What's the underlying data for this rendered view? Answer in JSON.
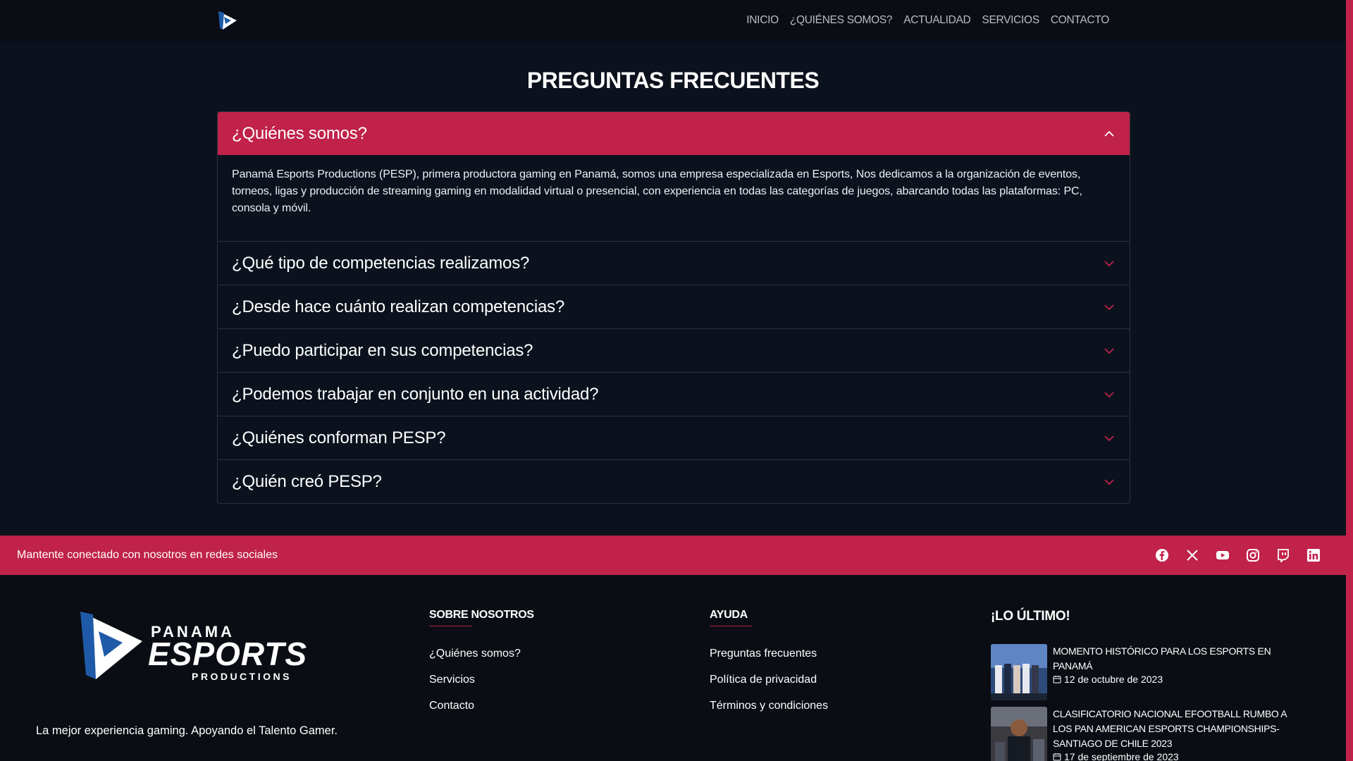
{
  "nav": {
    "items": [
      "INICIO",
      "¿QUIÉNES SOMOS?",
      "ACTUALIDAD",
      "SERVICIOS",
      "CONTACTO"
    ]
  },
  "page": {
    "title": "PREGUNTAS FRECUENTES"
  },
  "faq": {
    "items": [
      {
        "question": "¿Quiénes somos?",
        "answer": "Panamá Esports Productions (PESP), primera productora gaming en Panamá, somos una empresa especializada en Esports, Nos dedicamos a la organización de eventos, torneos, ligas y producción de streaming gaming en modalidad virtual o presencial, con experiencia en todas las categorías de juegos, abarcando todas las plataformas: PC, consola y móvil.",
        "open": true
      },
      {
        "question": "¿Qué tipo de competencias realizamos?",
        "open": false
      },
      {
        "question": "¿Desde hace cuánto realizan competencias?",
        "open": false
      },
      {
        "question": "¿Puedo participar en sus competencias?",
        "open": false
      },
      {
        "question": "¿Podemos trabajar en conjunto en una actividad?",
        "open": false
      },
      {
        "question": "¿Quiénes conforman PESP?",
        "open": false
      },
      {
        "question": "¿Quién creó PESP?",
        "open": false
      }
    ]
  },
  "social": {
    "text": "Mantente conectado con nosotros en redes sociales",
    "icons": [
      "facebook-icon",
      "x-icon",
      "youtube-icon",
      "instagram-icon",
      "twitch-icon",
      "linkedin-icon"
    ]
  },
  "footer": {
    "brand": {
      "panama": "PANAMA",
      "esports": "ESPORTS",
      "productions": "PRODUCTIONS",
      "tagline": "La mejor experiencia gaming. Apoyando el Talento Gamer."
    },
    "about": {
      "title": "SOBRE NOSOTROS",
      "links": [
        "¿Quiénes somos?",
        "Servicios",
        "Contacto"
      ]
    },
    "help": {
      "title": "AYUDA",
      "links": [
        "Preguntas frecuentes",
        "Política de privacidad",
        "Términos y condiciones"
      ]
    },
    "latest": {
      "title": "¡LO ÚLTIMO!",
      "news": [
        {
          "title": "MOMENTO HISTÓRICO PARA LOS ESPORTS EN PANAMÁ",
          "date": "12 de octubre de 2023"
        },
        {
          "title": "CLASIFICATORIO NACIONAL EFOOTBALL RUMBO A LOS PAN AMERICAN ESPORTS CHAMPIONSHIPS-SANTIAGO DE CHILE 2023",
          "date": "17 de septiembre de 2023"
        }
      ]
    }
  },
  "colors": {
    "accent": "#c0224a",
    "background": "#0b121d",
    "header": "#0a0d13"
  }
}
